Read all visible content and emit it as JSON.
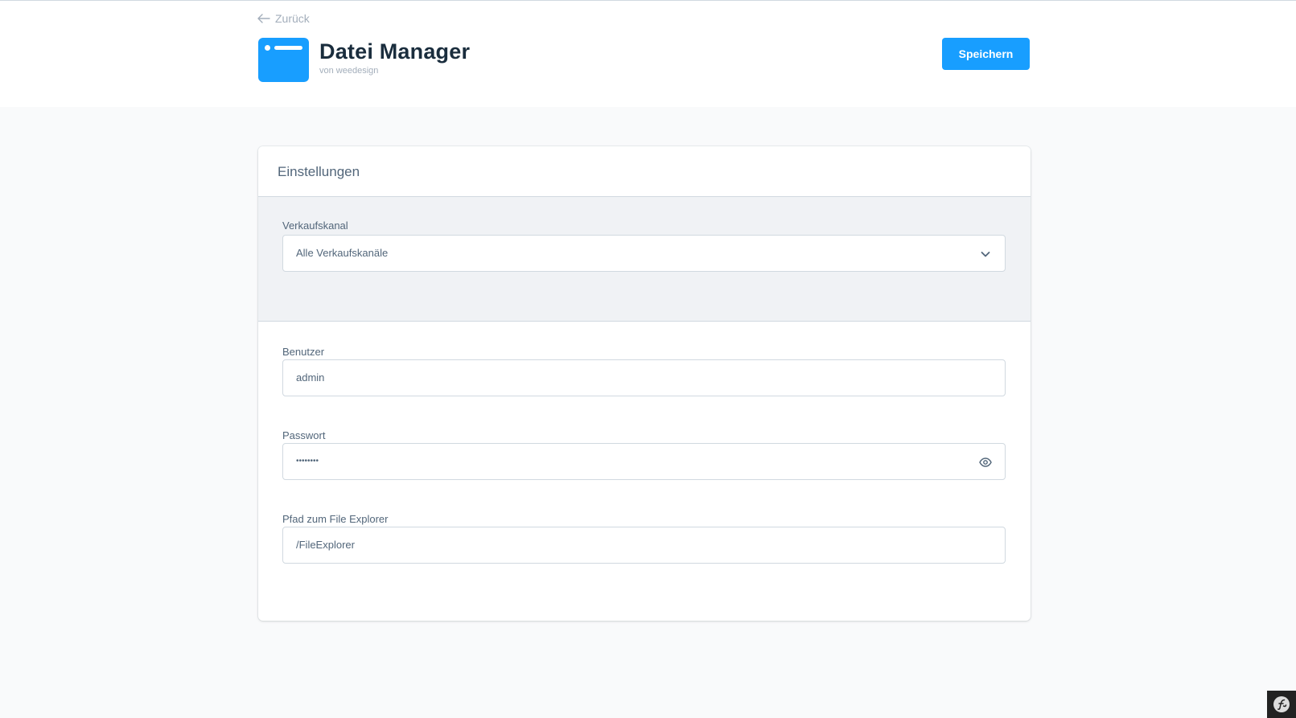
{
  "header": {
    "back_label": "Zurück",
    "app_title": "Datei Manager",
    "app_vendor": "von weedesign",
    "save_label": "Speichern",
    "accent_color": "#189eff"
  },
  "settings": {
    "title": "Einstellungen",
    "sales_channel": {
      "label": "Verkaufskanal",
      "selected": "Alle Verkaufskanäle"
    },
    "fields": {
      "user": {
        "label": "Benutzer",
        "value": "admin"
      },
      "password": {
        "label": "Passwort",
        "value": "••••••••"
      },
      "path": {
        "label": "Pfad zum File Explorer",
        "value": "/FileExplorer"
      }
    }
  },
  "icons": {
    "back": "arrow-left-icon",
    "app": "window-icon",
    "select": "chevron-down-icon",
    "reveal": "eye-icon",
    "toolbar": "symfony-icon"
  }
}
